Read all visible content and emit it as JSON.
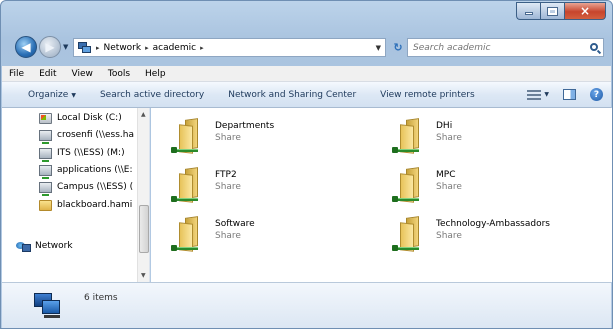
{
  "window": {
    "caption": {
      "close_glyph": "×"
    }
  },
  "nav": {
    "back_glyph": "◀",
    "forward_glyph": "▶",
    "recent_glyph": "▼",
    "breadcrumbs": [
      "Network",
      "academic"
    ],
    "crumb_separator": "▸",
    "address_dropdown_glyph": "▼",
    "refresh_glyph": "↻",
    "search_placeholder": "Search academic"
  },
  "menu": [
    "File",
    "Edit",
    "View",
    "Tools",
    "Help"
  ],
  "commands": {
    "organize": "Organize",
    "organize_arrow": "▼",
    "items": [
      "Search active directory",
      "Network and Sharing Center",
      "View remote printers"
    ],
    "views_arrow": "▼",
    "help_glyph": "?"
  },
  "navpane": {
    "items": [
      {
        "label": "Local Disk (C:)",
        "icon": "drive-icon"
      },
      {
        "label": "crosenfi (\\\\ess.ha",
        "icon": "network-drive-icon"
      },
      {
        "label": "ITS (\\\\ESS) (M:)",
        "icon": "network-drive-icon"
      },
      {
        "label": "applications (\\\\E:",
        "icon": "network-drive-icon"
      },
      {
        "label": "Campus (\\\\ESS) (",
        "icon": "network-drive-icon"
      },
      {
        "label": "blackboard.hami",
        "icon": "folder-icon"
      }
    ],
    "network_label": "Network",
    "scroll_up_glyph": "▲",
    "scroll_down_glyph": "▼"
  },
  "shares": [
    {
      "name": "Departments",
      "type": "Share"
    },
    {
      "name": "DHi",
      "type": "Share"
    },
    {
      "name": "FTP2",
      "type": "Share"
    },
    {
      "name": "MPC",
      "type": "Share"
    },
    {
      "name": "Software",
      "type": "Share"
    },
    {
      "name": "Technology-Ambassadors",
      "type": "Share"
    }
  ],
  "details": {
    "count_text": "6 items"
  },
  "colors": {
    "accent": "#1e395b",
    "window_frame": "#a9c3df",
    "share_cable": "#2b8a2b"
  }
}
